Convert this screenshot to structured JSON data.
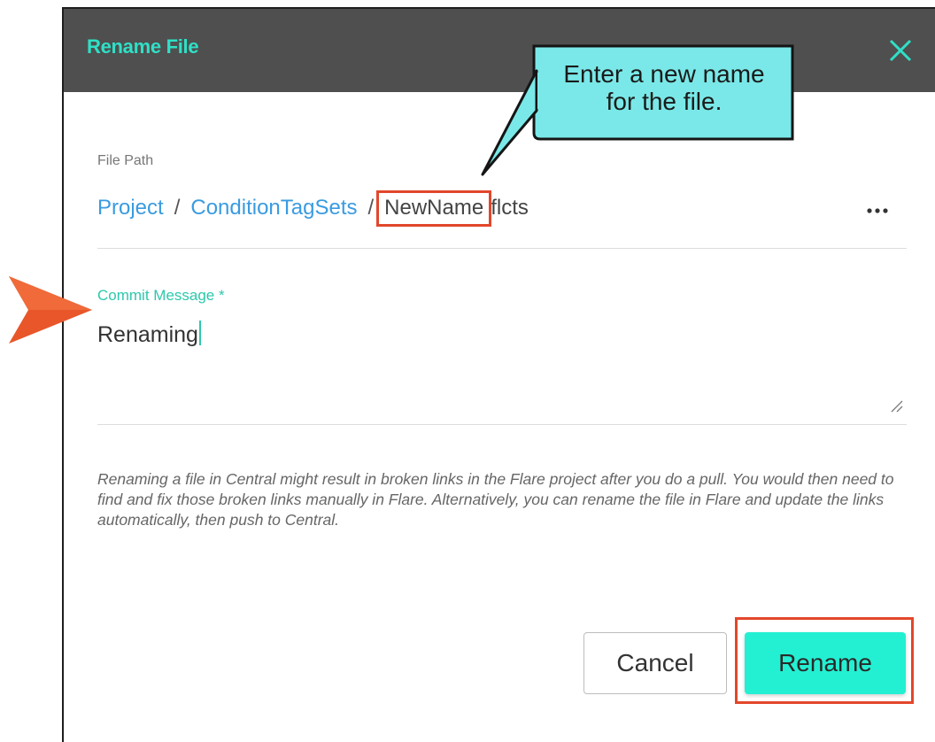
{
  "dialog": {
    "title": "Rename File",
    "close_icon": "close-icon"
  },
  "file_path": {
    "label": "File Path",
    "crumbs": [
      "Project",
      "ConditionTagSets"
    ],
    "separator": "/",
    "name": "NewName",
    "extension": "flcts",
    "more_label": "..."
  },
  "commit": {
    "label": "Commit Message *",
    "value": "Renaming"
  },
  "warning": "Renaming a file in Central might result in broken links in the Flare project after you do a pull. You would then need to find and fix those broken links manually in Flare. Alternatively, you can rename the file in Flare and update the links automatically, then push to Central.",
  "buttons": {
    "cancel": "Cancel",
    "rename": "Rename"
  },
  "callout": {
    "text_line1": "Enter a new name",
    "text_line2": "for the file."
  },
  "colors": {
    "header_bg": "#4f4f4f",
    "title": "#2fe0c6",
    "link": "#3a9be0",
    "accent": "#2dc8ab",
    "rename_button": "#23f0d2",
    "highlight": "#e2472b",
    "callout_bg": "#7ae8e8"
  }
}
